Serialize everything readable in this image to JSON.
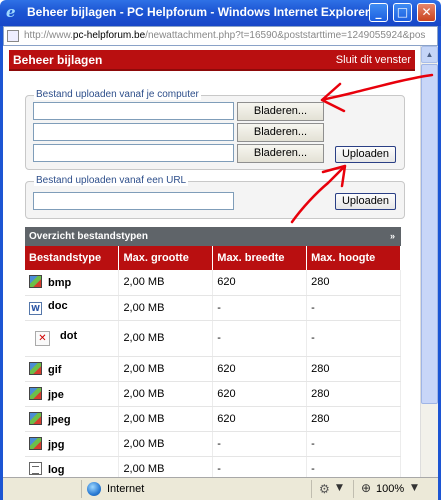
{
  "window": {
    "title": "Beheer bijlagen - PC Helpforum - Windows Internet Explorer",
    "url_prefix": "http://www.",
    "url_domain": "pc-helpforum.be",
    "url_rest": "/newattachment.php?t=16590&poststarttime=1249055924&pos"
  },
  "header": {
    "title": "Beheer bijlagen",
    "close_link": "Sluit dit venster"
  },
  "upload_computer": {
    "legend": "Bestand uploaden vanaf je computer",
    "browse_label": "Bladeren...",
    "upload_label": "Uploaden"
  },
  "upload_url": {
    "legend": "Bestand uploaden vanaf een URL",
    "upload_label": "Uploaden"
  },
  "types_panel": {
    "title": "Overzicht bestandstypen",
    "collapse_symbol": "»",
    "columns": [
      "Bestandstype",
      "Max. grootte",
      "Max. breedte",
      "Max. hoogte"
    ],
    "rows": [
      {
        "ext": "bmp",
        "icon": "image-file-icon",
        "size": "2,00 MB",
        "width": "620",
        "height": "280"
      },
      {
        "ext": "doc",
        "icon": "word-document-icon",
        "size": "2,00 MB",
        "width": "-",
        "height": "-"
      },
      {
        "ext": "dot",
        "icon": "broken-image-icon",
        "size": "2,00 MB",
        "width": "-",
        "height": "-"
      },
      {
        "ext": "gif",
        "icon": "image-file-icon",
        "size": "2,00 MB",
        "width": "620",
        "height": "280"
      },
      {
        "ext": "jpe",
        "icon": "image-file-icon",
        "size": "2,00 MB",
        "width": "620",
        "height": "280"
      },
      {
        "ext": "jpeg",
        "icon": "image-file-icon",
        "size": "2,00 MB",
        "width": "620",
        "height": "280"
      },
      {
        "ext": "jpg",
        "icon": "image-file-icon",
        "size": "2,00 MB",
        "width": "-",
        "height": "-"
      },
      {
        "ext": "log",
        "icon": "text-file-icon",
        "size": "2,00 MB",
        "width": "-",
        "height": "-"
      }
    ]
  },
  "statusbar": {
    "zone": "Internet",
    "zoom": "100%"
  },
  "colors": {
    "header_red": "#b90f10",
    "panel_grey": "#5f6469",
    "annotation_red": "#e8000b",
    "titlebar_blue": "#1c55d3"
  }
}
